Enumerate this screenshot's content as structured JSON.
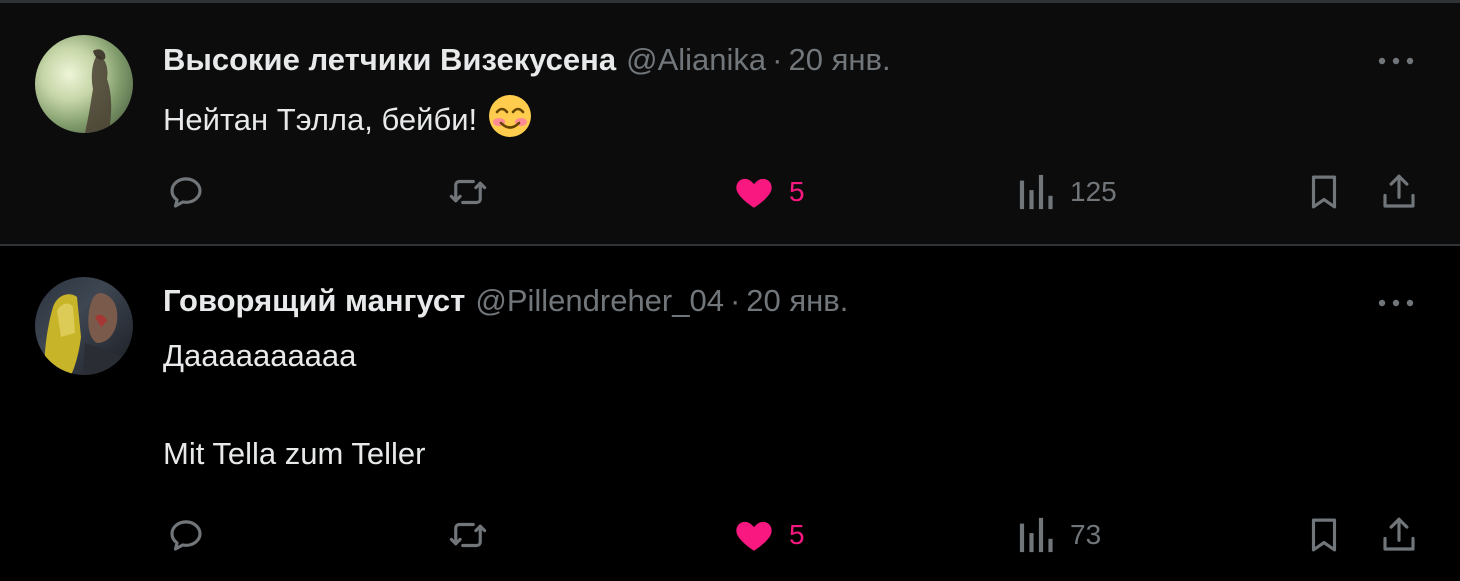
{
  "tweets": [
    {
      "display_name": "Высокие летчики Визекусена",
      "handle": "@Alianika",
      "separator": "·",
      "date": "20 янв.",
      "text_lines": [
        "Нейтан Тэлла, бейби!"
      ],
      "emoji": "smiling-face-emoji",
      "likes": "5",
      "views": "125",
      "liked": true
    },
    {
      "display_name": "Говорящий мангуст",
      "handle": "@Pillendreher_04",
      "separator": "·",
      "date": "20 янв.",
      "text_lines": [
        "Даааааааааа",
        "Mit Tella zum Teller"
      ],
      "likes": "5",
      "views": "73",
      "liked": true
    }
  ],
  "colors": {
    "background": "#000000",
    "text": "#e7e9ea",
    "muted": "#71767b",
    "like": "#f91880",
    "divider": "#2f3336"
  }
}
